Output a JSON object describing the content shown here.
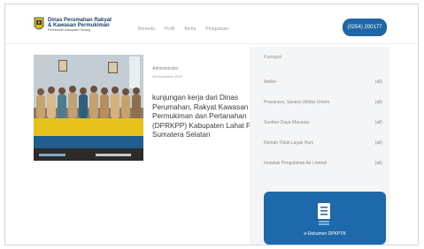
{
  "header": {
    "logo_line1": "Dinas Perumahan Rakyat",
    "logo_line2": "& Kawasan Permukiman",
    "logo_line3": "Pemerintah Kabupaten Serang",
    "nav": [
      "Beranda",
      "Profil",
      "Berita",
      "Pengaduan"
    ],
    "phone": "(0254) 200177"
  },
  "post": {
    "image_banner": "KUNJUNGAN KERJA DINAS PERUMAHAN RAKYAT KAWASAN PERMUKIMAN DAN PERTANAHAN KABUPATEN LAHAT PROVINSI SUMATERA SELATAN",
    "author": "Administrator",
    "date": "08 November 2022",
    "title_lines": [
      "kunjungan kerja dari Dinas",
      "Perumahan, Rakyat Kawasan",
      "Permukiman dan Pertanahan",
      "(DPRKPP) Kabupaten Lahat Provinsi",
      "Sumatera Selatan"
    ]
  },
  "sidebar": {
    "title": "Kategori",
    "categories": [
      {
        "name": "Artikel",
        "count": "(all)"
      },
      {
        "name": "Prasarana, Sarana Utilitas Umum",
        "count": "(all)"
      },
      {
        "name": "Sumber Daya Manusia",
        "count": "(all)"
      },
      {
        "name": "Rumah Tidak Layak Huni",
        "count": "(all)"
      },
      {
        "name": "Instalasi Pengolahan Air Limbah",
        "count": "(all)"
      }
    ],
    "edoc_label": "e-Dokumen DPKPTB"
  },
  "colors": {
    "brand_blue": "#1e66a6",
    "sidebar_bg": "#f4f5f6",
    "text_dark": "#3a3a3a"
  }
}
